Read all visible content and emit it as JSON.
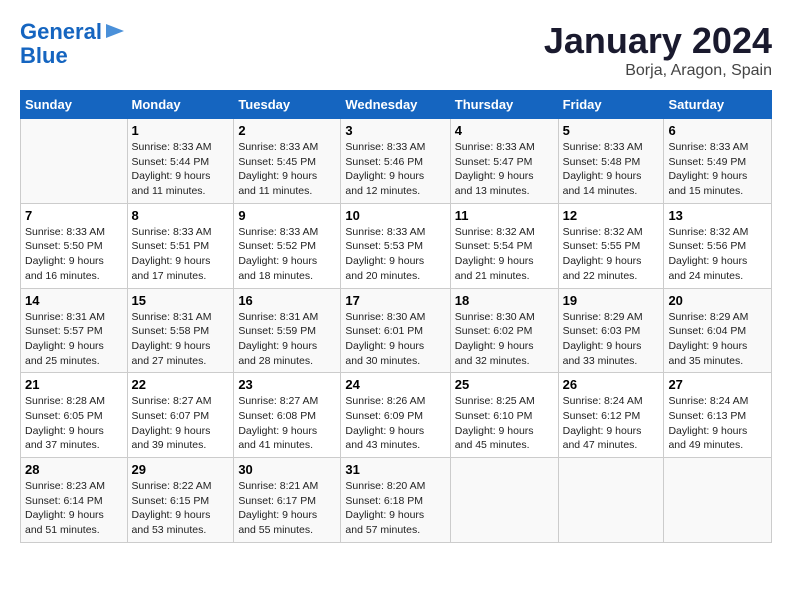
{
  "logo": {
    "line1": "General",
    "line2": "Blue"
  },
  "title": "January 2024",
  "subtitle": "Borja, Aragon, Spain",
  "days_of_week": [
    "Sunday",
    "Monday",
    "Tuesday",
    "Wednesday",
    "Thursday",
    "Friday",
    "Saturday"
  ],
  "weeks": [
    [
      {
        "num": "",
        "info": ""
      },
      {
        "num": "1",
        "info": "Sunrise: 8:33 AM\nSunset: 5:44 PM\nDaylight: 9 hours\nand 11 minutes."
      },
      {
        "num": "2",
        "info": "Sunrise: 8:33 AM\nSunset: 5:45 PM\nDaylight: 9 hours\nand 11 minutes."
      },
      {
        "num": "3",
        "info": "Sunrise: 8:33 AM\nSunset: 5:46 PM\nDaylight: 9 hours\nand 12 minutes."
      },
      {
        "num": "4",
        "info": "Sunrise: 8:33 AM\nSunset: 5:47 PM\nDaylight: 9 hours\nand 13 minutes."
      },
      {
        "num": "5",
        "info": "Sunrise: 8:33 AM\nSunset: 5:48 PM\nDaylight: 9 hours\nand 14 minutes."
      },
      {
        "num": "6",
        "info": "Sunrise: 8:33 AM\nSunset: 5:49 PM\nDaylight: 9 hours\nand 15 minutes."
      }
    ],
    [
      {
        "num": "7",
        "info": "Sunrise: 8:33 AM\nSunset: 5:50 PM\nDaylight: 9 hours\nand 16 minutes."
      },
      {
        "num": "8",
        "info": "Sunrise: 8:33 AM\nSunset: 5:51 PM\nDaylight: 9 hours\nand 17 minutes."
      },
      {
        "num": "9",
        "info": "Sunrise: 8:33 AM\nSunset: 5:52 PM\nDaylight: 9 hours\nand 18 minutes."
      },
      {
        "num": "10",
        "info": "Sunrise: 8:33 AM\nSunset: 5:53 PM\nDaylight: 9 hours\nand 20 minutes."
      },
      {
        "num": "11",
        "info": "Sunrise: 8:32 AM\nSunset: 5:54 PM\nDaylight: 9 hours\nand 21 minutes."
      },
      {
        "num": "12",
        "info": "Sunrise: 8:32 AM\nSunset: 5:55 PM\nDaylight: 9 hours\nand 22 minutes."
      },
      {
        "num": "13",
        "info": "Sunrise: 8:32 AM\nSunset: 5:56 PM\nDaylight: 9 hours\nand 24 minutes."
      }
    ],
    [
      {
        "num": "14",
        "info": "Sunrise: 8:31 AM\nSunset: 5:57 PM\nDaylight: 9 hours\nand 25 minutes."
      },
      {
        "num": "15",
        "info": "Sunrise: 8:31 AM\nSunset: 5:58 PM\nDaylight: 9 hours\nand 27 minutes."
      },
      {
        "num": "16",
        "info": "Sunrise: 8:31 AM\nSunset: 5:59 PM\nDaylight: 9 hours\nand 28 minutes."
      },
      {
        "num": "17",
        "info": "Sunrise: 8:30 AM\nSunset: 6:01 PM\nDaylight: 9 hours\nand 30 minutes."
      },
      {
        "num": "18",
        "info": "Sunrise: 8:30 AM\nSunset: 6:02 PM\nDaylight: 9 hours\nand 32 minutes."
      },
      {
        "num": "19",
        "info": "Sunrise: 8:29 AM\nSunset: 6:03 PM\nDaylight: 9 hours\nand 33 minutes."
      },
      {
        "num": "20",
        "info": "Sunrise: 8:29 AM\nSunset: 6:04 PM\nDaylight: 9 hours\nand 35 minutes."
      }
    ],
    [
      {
        "num": "21",
        "info": "Sunrise: 8:28 AM\nSunset: 6:05 PM\nDaylight: 9 hours\nand 37 minutes."
      },
      {
        "num": "22",
        "info": "Sunrise: 8:27 AM\nSunset: 6:07 PM\nDaylight: 9 hours\nand 39 minutes."
      },
      {
        "num": "23",
        "info": "Sunrise: 8:27 AM\nSunset: 6:08 PM\nDaylight: 9 hours\nand 41 minutes."
      },
      {
        "num": "24",
        "info": "Sunrise: 8:26 AM\nSunset: 6:09 PM\nDaylight: 9 hours\nand 43 minutes."
      },
      {
        "num": "25",
        "info": "Sunrise: 8:25 AM\nSunset: 6:10 PM\nDaylight: 9 hours\nand 45 minutes."
      },
      {
        "num": "26",
        "info": "Sunrise: 8:24 AM\nSunset: 6:12 PM\nDaylight: 9 hours\nand 47 minutes."
      },
      {
        "num": "27",
        "info": "Sunrise: 8:24 AM\nSunset: 6:13 PM\nDaylight: 9 hours\nand 49 minutes."
      }
    ],
    [
      {
        "num": "28",
        "info": "Sunrise: 8:23 AM\nSunset: 6:14 PM\nDaylight: 9 hours\nand 51 minutes."
      },
      {
        "num": "29",
        "info": "Sunrise: 8:22 AM\nSunset: 6:15 PM\nDaylight: 9 hours\nand 53 minutes."
      },
      {
        "num": "30",
        "info": "Sunrise: 8:21 AM\nSunset: 6:17 PM\nDaylight: 9 hours\nand 55 minutes."
      },
      {
        "num": "31",
        "info": "Sunrise: 8:20 AM\nSunset: 6:18 PM\nDaylight: 9 hours\nand 57 minutes."
      },
      {
        "num": "",
        "info": ""
      },
      {
        "num": "",
        "info": ""
      },
      {
        "num": "",
        "info": ""
      }
    ]
  ]
}
